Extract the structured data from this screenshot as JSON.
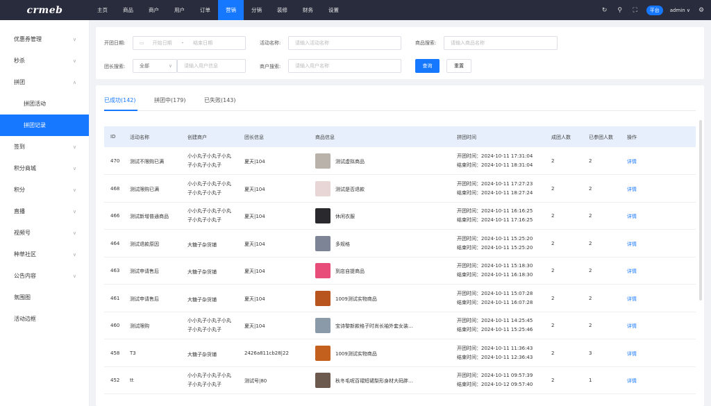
{
  "brand": "crmeb",
  "topnav": [
    "主页",
    "商品",
    "商户",
    "用户",
    "订单",
    "营销",
    "分销",
    "装修",
    "财务",
    "设置"
  ],
  "topnav_active": 5,
  "topright": {
    "platform_badge": "平台",
    "user": "admin ∨"
  },
  "sidebar": {
    "items": [
      {
        "label": "优惠券管理",
        "chev": "∨"
      },
      {
        "label": "秒杀",
        "chev": "∨"
      },
      {
        "label": "拼团",
        "chev": "∧"
      }
    ],
    "sub": [
      "拼团活动",
      "拼团记录"
    ],
    "items2": [
      {
        "label": "签到",
        "chev": "∨"
      },
      {
        "label": "积分商城",
        "chev": "∨"
      },
      {
        "label": "积分",
        "chev": "∨"
      },
      {
        "label": "直播",
        "chev": "∨"
      },
      {
        "label": "视频号",
        "chev": "∨"
      },
      {
        "label": "种草社区",
        "chev": "∨"
      },
      {
        "label": "公告内容",
        "chev": "∨"
      },
      {
        "label": "氛围图",
        "chev": ""
      },
      {
        "label": "活动边框",
        "chev": ""
      }
    ]
  },
  "filter": {
    "date_label": "开团日期:",
    "date_start": "开始日期",
    "date_sep": "-",
    "date_end": "结束日期",
    "activity_label": "活动名称:",
    "activity_ph": "请输入活动名称",
    "product_label": "商品搜索:",
    "product_ph": "请输入商品名称",
    "leader_label": "团长搜索:",
    "leader_select": "全部",
    "leader_ph": "请输入用户信息",
    "merchant_label": "商户搜索:",
    "merchant_ph": "请输入用户名称",
    "query": "查询",
    "reset": "重置"
  },
  "tabs": [
    "已成功(142)",
    "拼团中(179)",
    "已失败(143)"
  ],
  "table": {
    "headers": [
      "ID",
      "活动名称",
      "创建商户",
      "团长信息",
      "商品信息",
      "拼团时间",
      "成团人数",
      "已参团人数",
      "操作"
    ],
    "rows": [
      {
        "id": "470",
        "name": "测试不限购已满",
        "merchant": [
          "小小丸子小丸子小丸",
          "子小丸子小丸子"
        ],
        "leader": "夏天|104",
        "product": "测试虚拟商品",
        "start": "开团时间：2024-10-11 17:31:04",
        "end": "结束时间：2024-10-11 18:31:04",
        "size": "2",
        "joined": "2",
        "action": "详情"
      },
      {
        "id": "468",
        "name": "测试限购已满",
        "merchant": [
          "小小丸子小丸子小丸",
          "子小丸子小丸子"
        ],
        "leader": "夏天|104",
        "product": "测试是否退款",
        "start": "开团时间：2024-10-11 17:27:23",
        "end": "结束时间：2024-10-11 18:27:24",
        "size": "2",
        "joined": "2",
        "action": "详情"
      },
      {
        "id": "466",
        "name": "测试新增普通商品",
        "merchant": [
          "小小丸子小丸子小丸",
          "子小丸子小丸子"
        ],
        "leader": "夏天|104",
        "product": "休闲衣服",
        "start": "开团时间：2024-10-11 16:16:25",
        "end": "结束时间：2024-10-11 17:16:25",
        "size": "2",
        "joined": "2",
        "action": "详情"
      },
      {
        "id": "464",
        "name": "测试退款原因",
        "merchant": [
          "大糖子杂货铺"
        ],
        "leader": "夏天|104",
        "product": "多规格",
        "start": "开团时间：2024-10-11 15:25:20",
        "end": "结束时间：2024-10-11 15:25:20",
        "size": "2",
        "joined": "2",
        "action": "详情"
      },
      {
        "id": "463",
        "name": "测试申请售后",
        "merchant": [
          "大糖子杂货铺"
        ],
        "leader": "夏天|104",
        "product": "到店自提商品",
        "start": "开团时间：2024-10-11 15:18:30",
        "end": "结束时间：2024-10-11 16:18:30",
        "size": "2",
        "joined": "2",
        "action": "详情"
      },
      {
        "id": "461",
        "name": "测试申请售后",
        "merchant": [
          "大糖子杂货铺"
        ],
        "leader": "夏天|104",
        "product": "1009测试实物商品",
        "start": "开团时间：2024-10-11 15:07:28",
        "end": "结束时间：2024-10-11 16:07:28",
        "size": "2",
        "joined": "2",
        "action": "详情"
      },
      {
        "id": "460",
        "name": "测试限购",
        "merchant": [
          "小小丸子小丸子小丸",
          "子小丸子小丸子"
        ],
        "leader": "夏天|104",
        "product": "宝诗黎新款格子时尚长袖外套女装…",
        "start": "开团时间：2024-10-11 14:25:45",
        "end": "结束时间：2024-10-11 15:25:46",
        "size": "2",
        "joined": "2",
        "action": "详情"
      },
      {
        "id": "458",
        "name": "T3",
        "merchant": [
          "大糖子杂货铺"
        ],
        "leader": "2426a811cb28|22",
        "product": "1009测试实物商品",
        "start": "开团时间：2024-10-11 11:36:43",
        "end": "结束时间：2024-10-11 12:36:43",
        "size": "2",
        "joined": "3",
        "action": "详情"
      },
      {
        "id": "452",
        "name": "tt",
        "merchant": [
          "小小丸子小丸子小丸",
          "子小丸子小丸子"
        ],
        "leader": "测试号|80",
        "product": "秋冬毛呢百褶短裙梨形身材大码胖…",
        "start": "开团时间：2024-10-11 09:57:39",
        "end": "结束时间：2024-10-12 09:57:40",
        "size": "2",
        "joined": "1",
        "action": "详情"
      }
    ]
  },
  "thumb_colors": [
    "#b9b2ab",
    "#e8d5d5",
    "#2a2a2e",
    "#7d8496",
    "#e84d7a",
    "#b8541d",
    "#8a9aa8",
    "#c4601e",
    "#6b5a4d"
  ]
}
